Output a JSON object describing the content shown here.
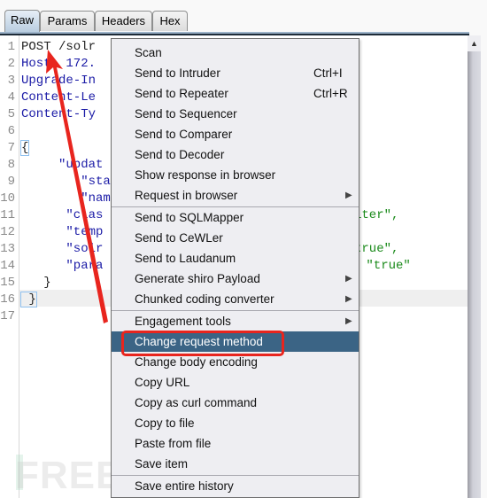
{
  "tabs": [
    {
      "label": "Raw",
      "active": true
    },
    {
      "label": "Params",
      "active": false
    },
    {
      "label": "Headers",
      "active": false
    },
    {
      "label": "Hex",
      "active": false
    }
  ],
  "editor": {
    "line_numbers": [
      "1",
      "2",
      "3",
      "4",
      "5",
      "6",
      "7",
      "8",
      "9",
      "10",
      "11",
      "12",
      "13",
      "14",
      "15",
      "16",
      "17"
    ],
    "lines": [
      {
        "text": "POST /solr",
        "color": "black"
      },
      {
        "text": "Host: 172.",
        "color": "blue"
      },
      {
        "text": "Upgrade-In",
        "color": "blue"
      },
      {
        "text": "Content-Le",
        "color": "blue"
      },
      {
        "text": "Content-Ty",
        "color": "blue"
      },
      {
        "text": "",
        "color": "blue"
      },
      {
        "text": "{",
        "color": "black"
      },
      {
        "text": "     \"updat",
        "color": "blue"
      },
      {
        "text": "        \"sta",
        "color": "blue"
      },
      {
        "text": "        \"nam",
        "color": "blue"
      },
      {
        "text": "      \"clas",
        "color": "blue",
        "tail": "iter\","
      },
      {
        "text": "      \"temp",
        "color": "blue"
      },
      {
        "text": "      \"solr",
        "color": "blue",
        "tail": "true\","
      },
      {
        "text": "      \"para",
        "color": "blue",
        "tail": " \"true\""
      },
      {
        "text": "   }",
        "color": "black"
      },
      {
        "text": " }",
        "color": "black"
      },
      {
        "text": "",
        "color": "black"
      }
    ]
  },
  "context_menu": {
    "groups": [
      [
        {
          "label": "Scan"
        },
        {
          "label": "Send to Intruder",
          "shortcut": "Ctrl+I"
        },
        {
          "label": "Send to Repeater",
          "shortcut": "Ctrl+R"
        },
        {
          "label": "Send to Sequencer"
        },
        {
          "label": "Send to Comparer"
        },
        {
          "label": "Send to Decoder"
        },
        {
          "label": "Show response in browser"
        },
        {
          "label": "Request in browser",
          "submenu": true
        }
      ],
      [
        {
          "label": "Send to SQLMapper"
        },
        {
          "label": "Send to CeWLer"
        },
        {
          "label": "Send to Laudanum"
        },
        {
          "label": "Generate shiro Payload",
          "submenu": true
        },
        {
          "label": "Chunked coding converter",
          "submenu": true
        }
      ],
      [
        {
          "label": "Engagement tools",
          "submenu": true
        },
        {
          "label": "Change request method",
          "selected": true
        },
        {
          "label": "Change body encoding"
        },
        {
          "label": "Copy URL"
        },
        {
          "label": "Copy as curl command"
        },
        {
          "label": "Copy to file"
        },
        {
          "label": "Paste from file"
        },
        {
          "label": "Save item"
        }
      ],
      [
        {
          "label": "Save entire history"
        }
      ]
    ]
  },
  "watermark": "FREEBUF",
  "colors": {
    "selected_bg": "#3b6485",
    "annotation_red": "#e8251e",
    "header_blue": "#1a1aa6",
    "string_green": "#1a8a1a"
  }
}
